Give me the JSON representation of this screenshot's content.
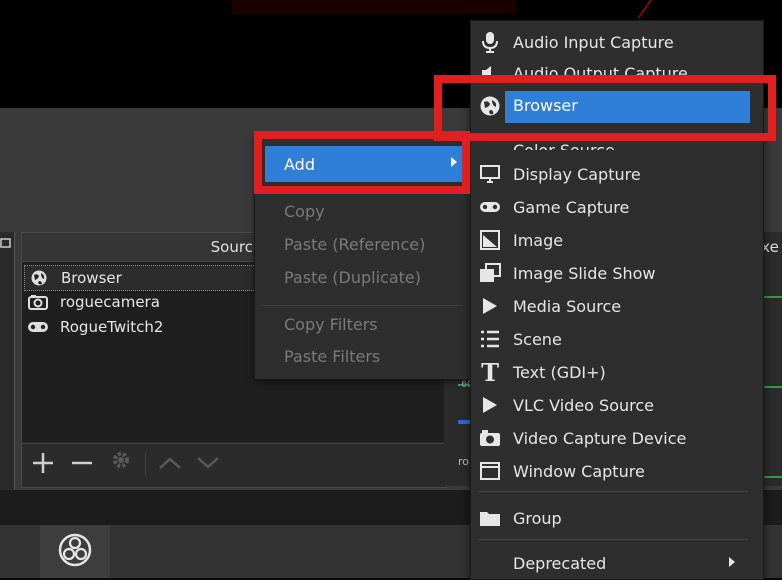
{
  "sources": {
    "title": "Sources",
    "items": [
      {
        "name": "Browser",
        "icon": "globe-icon"
      },
      {
        "name": "roguecamera",
        "icon": "camera-icon"
      },
      {
        "name": "RogueTwitch2",
        "icon": "gamepad-icon"
      }
    ]
  },
  "mixer": {
    "title_fragment": "ixe",
    "row_label": "ro",
    "meter_text": "-60"
  },
  "context_menu": {
    "add": "Add",
    "copy": "Copy",
    "paste_reference": "Paste (Reference)",
    "paste_duplicate": "Paste (Duplicate)",
    "copy_filters": "Copy Filters",
    "paste_filters": "Paste Filters"
  },
  "add_submenu": {
    "items": [
      {
        "label": "Audio Input Capture",
        "icon": "microphone-icon"
      },
      {
        "label": "Audio Output Capture",
        "icon": "speaker-icon"
      },
      {
        "label": "Browser",
        "icon": "globe-icon"
      },
      {
        "label": "Color Source",
        "icon": "paint-brush-icon"
      },
      {
        "label": "Display Capture",
        "icon": "monitor-icon"
      },
      {
        "label": "Game Capture",
        "icon": "gamepad-icon"
      },
      {
        "label": "Image",
        "icon": "image-icon"
      },
      {
        "label": "Image Slide Show",
        "icon": "slideshow-icon"
      },
      {
        "label": "Media Source",
        "icon": "play-icon"
      },
      {
        "label": "Scene",
        "icon": "list-icon"
      },
      {
        "label": "Text (GDI+)",
        "icon": "text-icon"
      },
      {
        "label": "VLC Video Source",
        "icon": "play-icon"
      },
      {
        "label": "Video Capture Device",
        "icon": "camera-icon"
      },
      {
        "label": "Window Capture",
        "icon": "window-icon"
      },
      {
        "label": "Group",
        "icon": "folder-icon"
      },
      {
        "label": "Deprecated",
        "icon": ""
      }
    ]
  },
  "colors": {
    "highlight": "#2f7fd9",
    "annotation_red": "#e02020",
    "menu_bg": "#2e2e2e"
  }
}
